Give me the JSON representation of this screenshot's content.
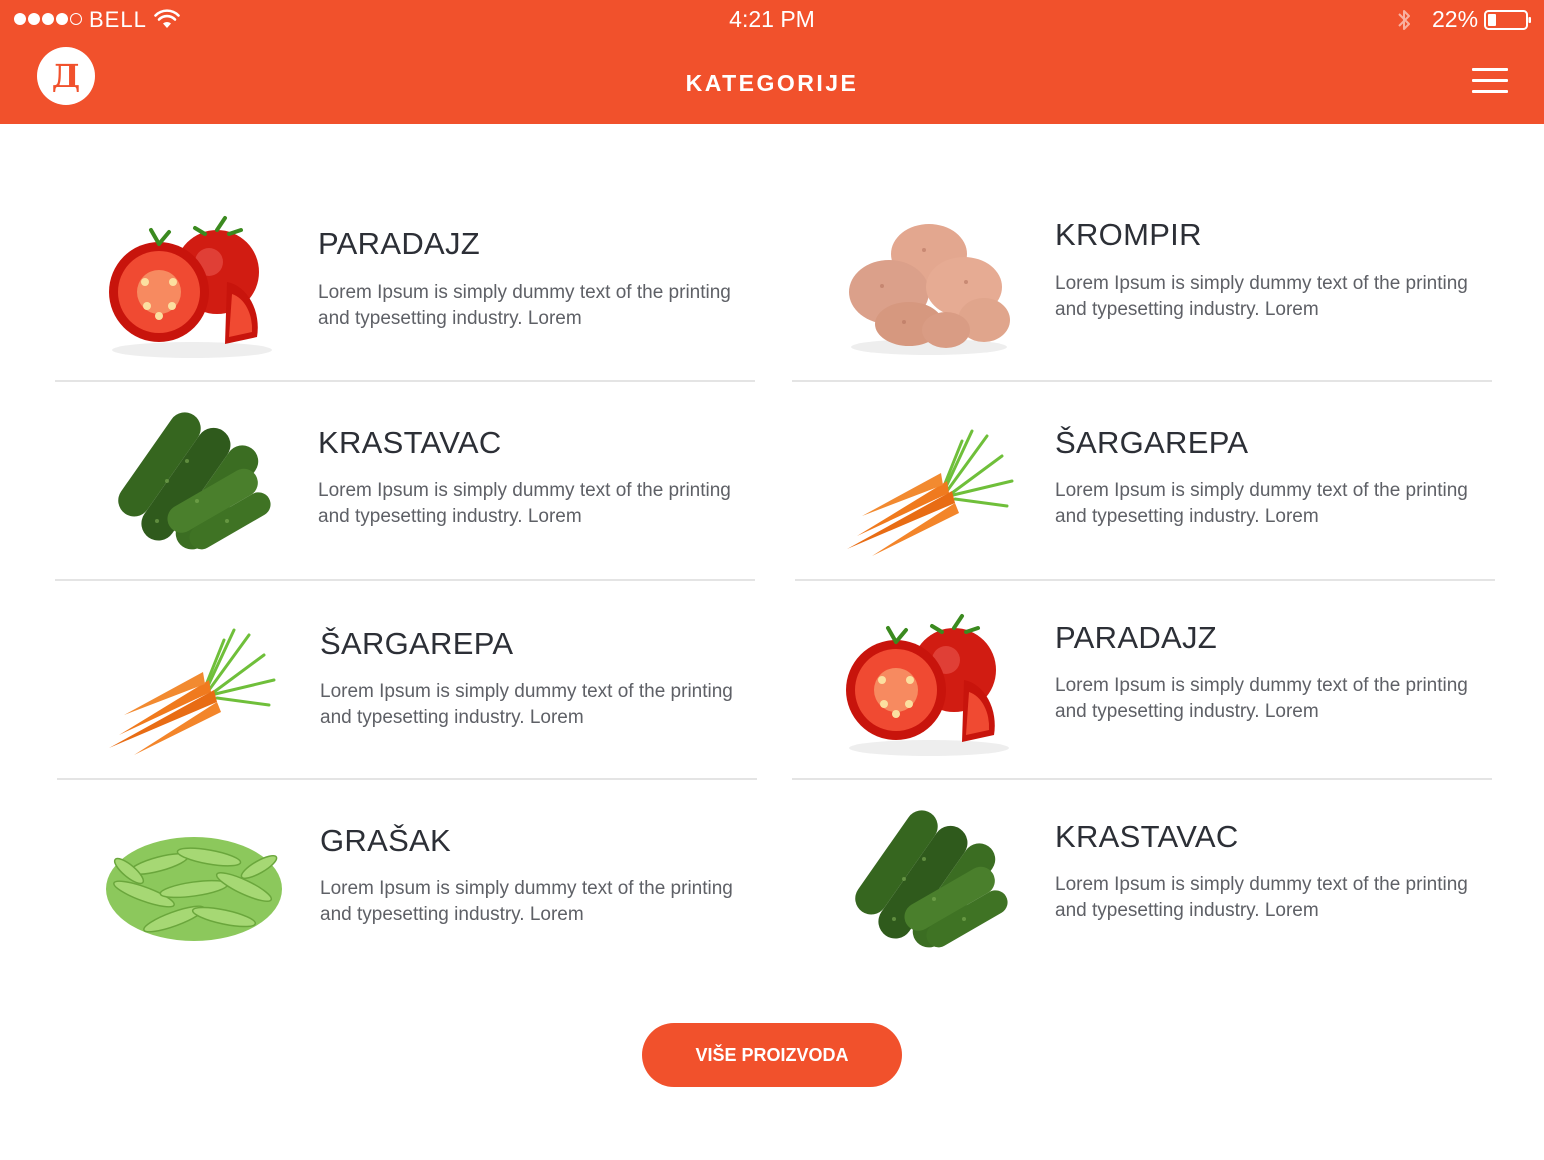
{
  "status_bar": {
    "carrier": "BELL",
    "time": "4:21 PM",
    "battery": "22%",
    "icons": [
      "signal-icon",
      "wifi-icon",
      "bluetooth-icon",
      "battery-icon"
    ]
  },
  "header": {
    "logo": "Д",
    "title": "KATEGORIJE",
    "menu_icon": "hamburger-menu-icon",
    "background_color": "#f1512c"
  },
  "categories": [
    {
      "title": "PARADAJZ",
      "image": "tomato",
      "description": "Lorem Ipsum is simply dummy text of the printing and typesetting industry. Lorem"
    },
    {
      "title": "KROMPIR",
      "image": "potato",
      "description": "Lorem Ipsum is simply dummy text of the printing and typesetting industry. Lorem"
    },
    {
      "title": "KRASTAVAC",
      "image": "cucumber",
      "description": "Lorem Ipsum is simply dummy text of the printing and typesetting industry. Lorem"
    },
    {
      "title": "ŠARGAREPA",
      "image": "carrot",
      "description": "Lorem Ipsum is simply dummy text of the printing and typesetting industry. Lorem"
    },
    {
      "title": "ŠARGAREPA",
      "image": "carrot",
      "description": "Lorem Ipsum is simply dummy text of the printing and typesetting industry. Lorem"
    },
    {
      "title": "PARADAJZ",
      "image": "tomato",
      "description": "Lorem Ipsum is simply dummy text of the printing and typesetting industry. Lorem"
    },
    {
      "title": "GRAŠAK",
      "image": "peas",
      "description": "Lorem Ipsum is simply dummy text of the printing and typesetting industry. Lorem"
    },
    {
      "title": "KRASTAVAC",
      "image": "cucumber",
      "description": "Lorem Ipsum is simply dummy text of the printing and typesetting industry. Lorem"
    }
  ],
  "more_button": {
    "label": "VIŠE PROIZVODA"
  }
}
